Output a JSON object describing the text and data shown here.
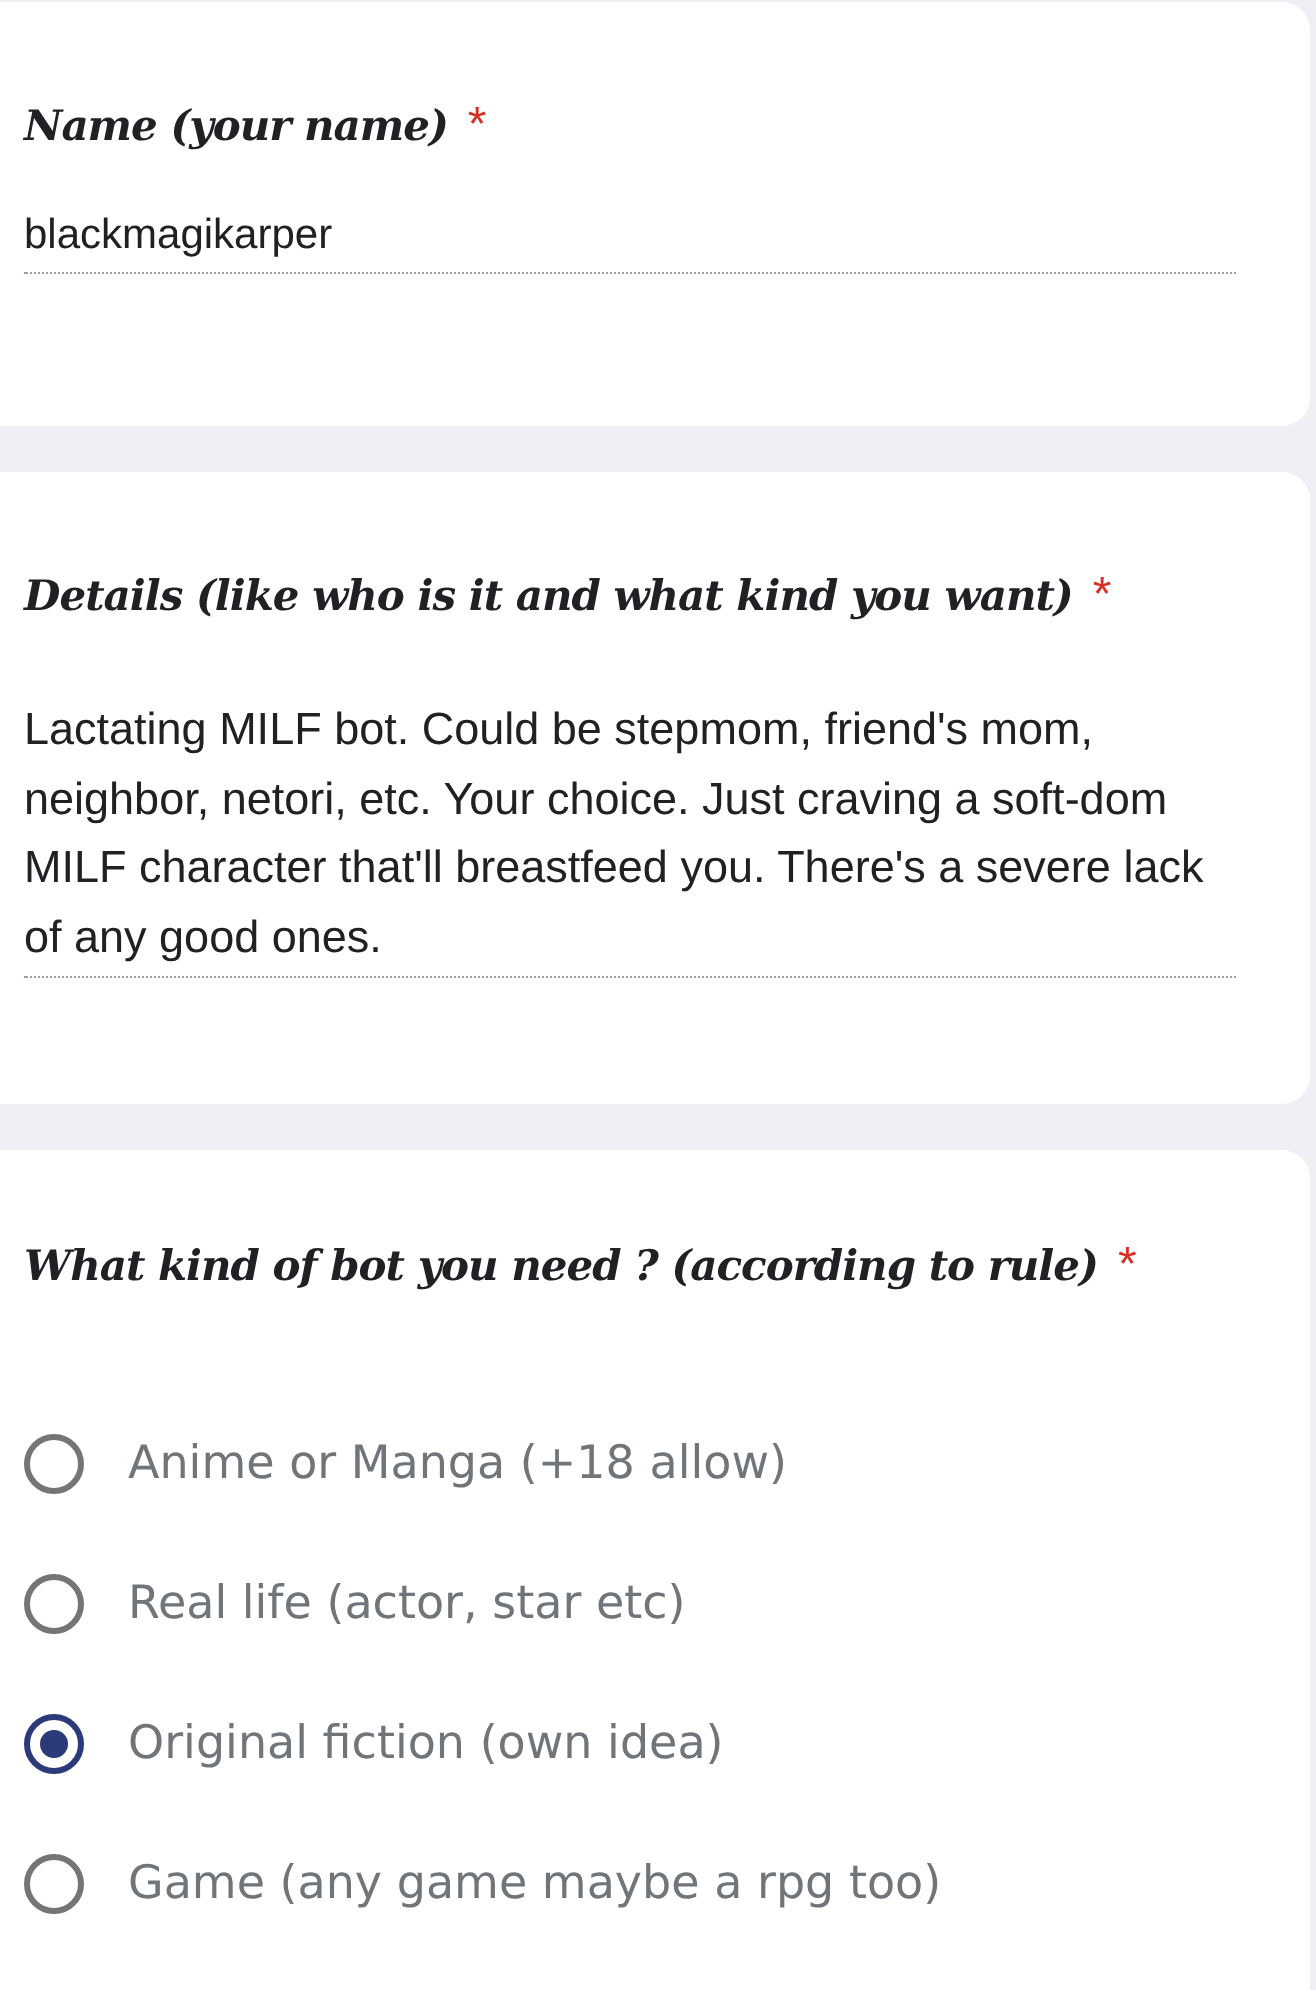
{
  "questions": [
    {
      "kind": "text",
      "title": "Name (your name)",
      "required_mark": "*",
      "answer": "blackmagikarper"
    },
    {
      "kind": "paragraph",
      "title": "Details (like who is it and what kind you want)",
      "required_mark": "*",
      "answer": "Lactating MILF bot. Could be stepmom, friend's mom, neighbor, netori, etc. Your choice. Just craving a soft-dom MILF character that'll breastfeed you. There's a severe lack of any good ones."
    },
    {
      "kind": "radio",
      "title": "What kind of bot you need ? (according to rule)",
      "required_mark": "*",
      "options": [
        {
          "label": "Anime or Manga (+18 allow)",
          "selected": false
        },
        {
          "label": "Real life (actor, star etc)",
          "selected": false
        },
        {
          "label": "Original fiction (own idea)",
          "selected": true
        },
        {
          "label": "Game (any game maybe a rpg too)",
          "selected": false
        }
      ]
    }
  ]
}
